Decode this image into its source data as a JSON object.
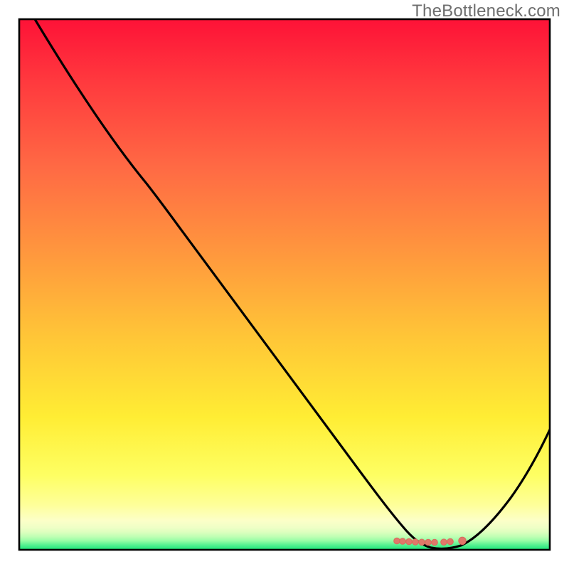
{
  "watermark": "TheBottleneck.com",
  "colors": {
    "gradient_top": "#fe1237",
    "gradient_upper": "#ff5642",
    "gradient_mid": "#ffb436",
    "gradient_lower_mid": "#ffe734",
    "gradient_near_bottom": "#feff7a",
    "gradient_band_cream": "#fdffc2",
    "gradient_band_pale": "#e9ffbd",
    "gradient_band_mint": "#b7ffb0",
    "gradient_band_green": "#25e87d",
    "curve_stroke": "#000000",
    "marker_fill": "#e0786a",
    "border": "#000000",
    "watermark_color": "#6e6e6e"
  },
  "chart_data": {
    "type": "line",
    "title": "",
    "xlabel": "",
    "ylabel": "",
    "xlim": [
      0,
      100
    ],
    "ylim": [
      0,
      100
    ],
    "grid": false,
    "legend": null,
    "annotations": [
      "TheBottleneck.com"
    ],
    "series": [
      {
        "name": "bottleneck-curve",
        "x": [
          3,
          10,
          20,
          24,
          30,
          40,
          50,
          60,
          68,
          70,
          72,
          74,
          76,
          78,
          80,
          82,
          85,
          90,
          95,
          100
        ],
        "y": [
          100,
          89,
          75,
          69,
          60,
          47,
          33,
          19,
          8,
          5,
          3,
          2,
          1.2,
          0.8,
          0.8,
          1.2,
          3,
          10,
          20,
          31
        ]
      }
    ],
    "markers": {
      "name": "minimum-cluster",
      "x": [
        70,
        71,
        72.3,
        73.5,
        74.8,
        76,
        77.2,
        79,
        80.2,
        82.5
      ],
      "y": [
        1.6,
        1.5,
        1.4,
        1.3,
        1.25,
        1.2,
        1.2,
        1.25,
        1.35,
        1.6
      ]
    }
  }
}
